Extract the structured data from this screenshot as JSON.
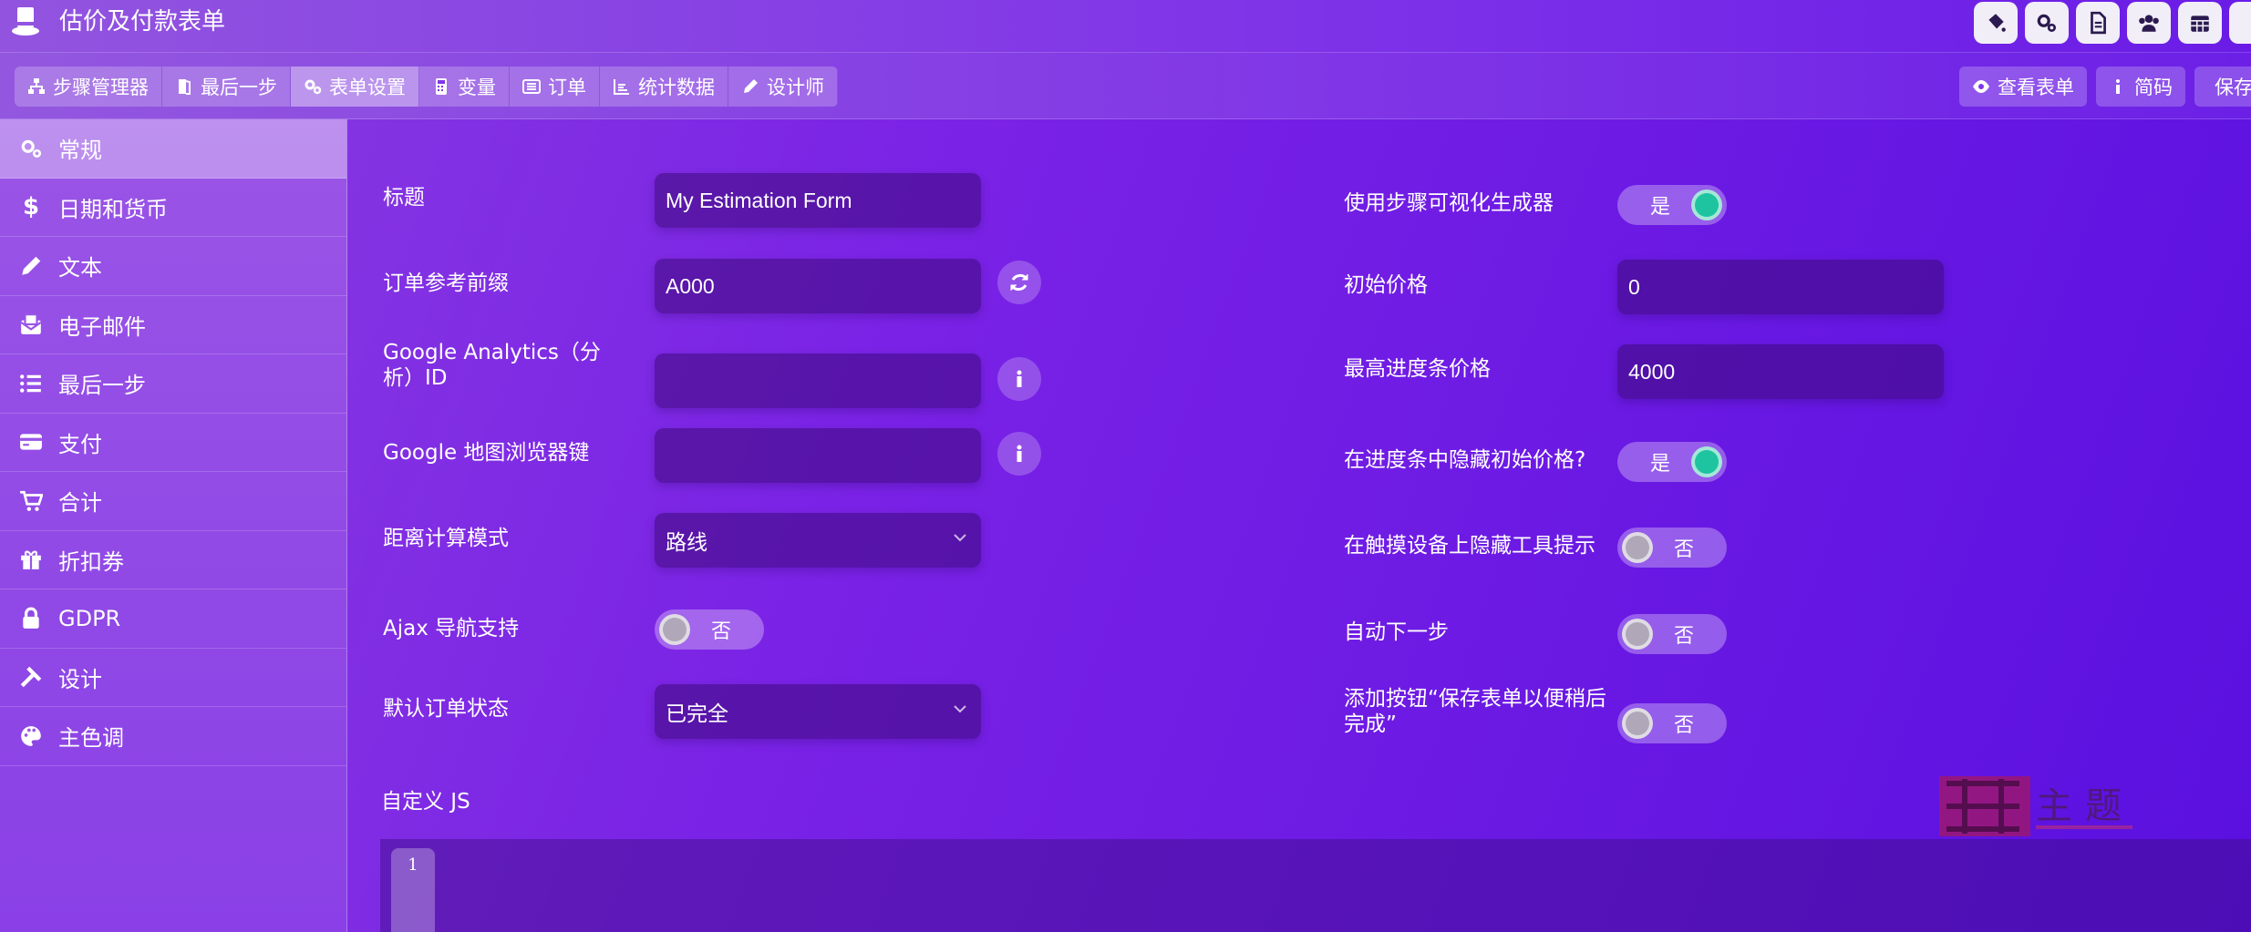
{
  "app": {
    "title": "估价及付款表单"
  },
  "top_icons": [
    "paint-bucket-icon",
    "cogs-icon",
    "file-icon",
    "users-icon",
    "calendar-icon",
    "extra-icon"
  ],
  "toolbar": {
    "left": [
      {
        "label": "步骤管理器",
        "icon": "sitemap-icon"
      },
      {
        "label": "最后一步",
        "icon": "door-icon"
      },
      {
        "label": "表单设置",
        "icon": "cogs-icon",
        "active": true
      },
      {
        "label": "变量",
        "icon": "calculator-icon"
      },
      {
        "label": "订单",
        "icon": "list-alt-icon"
      },
      {
        "label": "统计数据",
        "icon": "chart-icon"
      },
      {
        "label": "设计师",
        "icon": "pencil-icon"
      }
    ],
    "right": [
      {
        "label": "查看表单",
        "icon": "eye-icon"
      },
      {
        "label": "简码",
        "icon": "info-icon"
      },
      {
        "label": "保存",
        "icon": "save-icon"
      }
    ]
  },
  "sidebar": {
    "items": [
      {
        "label": "常规",
        "icon": "cogs-icon",
        "active": true
      },
      {
        "label": "日期和货币",
        "icon": "dollar-icon"
      },
      {
        "label": "文本",
        "icon": "pencil-icon"
      },
      {
        "label": "电子邮件",
        "icon": "envelope-icon"
      },
      {
        "label": "最后一步",
        "icon": "list-icon"
      },
      {
        "label": "支付",
        "icon": "credit-card-icon"
      },
      {
        "label": "合计",
        "icon": "cart-icon"
      },
      {
        "label": "折扣券",
        "icon": "gift-icon"
      },
      {
        "label": "GDPR",
        "icon": "lock-icon"
      },
      {
        "label": "设计",
        "icon": "tools-icon"
      },
      {
        "label": "主色调",
        "icon": "palette-icon"
      }
    ]
  },
  "form": {
    "title": {
      "label": "标题",
      "value": "My Estimation Form"
    },
    "order_prefix": {
      "label": "订单参考前缀",
      "value": "A000"
    },
    "ga_id": {
      "label": "Google Analytics（分析）ID",
      "value": ""
    },
    "maps_key": {
      "label": "Google 地图浏览器键",
      "value": ""
    },
    "distance_mode": {
      "label": "距离计算模式",
      "value": "路线"
    },
    "ajax_nav": {
      "label": "Ajax 导航支持",
      "value": "否"
    },
    "order_status": {
      "label": "默认订单状态",
      "value": "已完全"
    },
    "visual_builder": {
      "label": "使用步骤可视化生成器",
      "value": "是"
    },
    "initial_price": {
      "label": "初始价格",
      "value": "0"
    },
    "max_progress_price": {
      "label": "最高进度条价格",
      "value": "4000"
    },
    "hide_initial_price": {
      "label": "在进度条中隐藏初始价格?",
      "value": "是"
    },
    "hide_tooltips": {
      "label": "在触摸设备上隐藏工具提示",
      "value": "否"
    },
    "auto_next": {
      "label": "自动下一步",
      "value": "否"
    },
    "save_later": {
      "label": "添加按钮“保存表单以便稍后完成”",
      "value": "否"
    },
    "custom_js": {
      "label": "自定义 JS",
      "line": "1"
    }
  },
  "watermark": {
    "text": "主题"
  },
  "colors": {
    "accent": "#1ec4a0",
    "bg_start": "#8a3ee0",
    "bg_end": "#5a10e0"
  }
}
